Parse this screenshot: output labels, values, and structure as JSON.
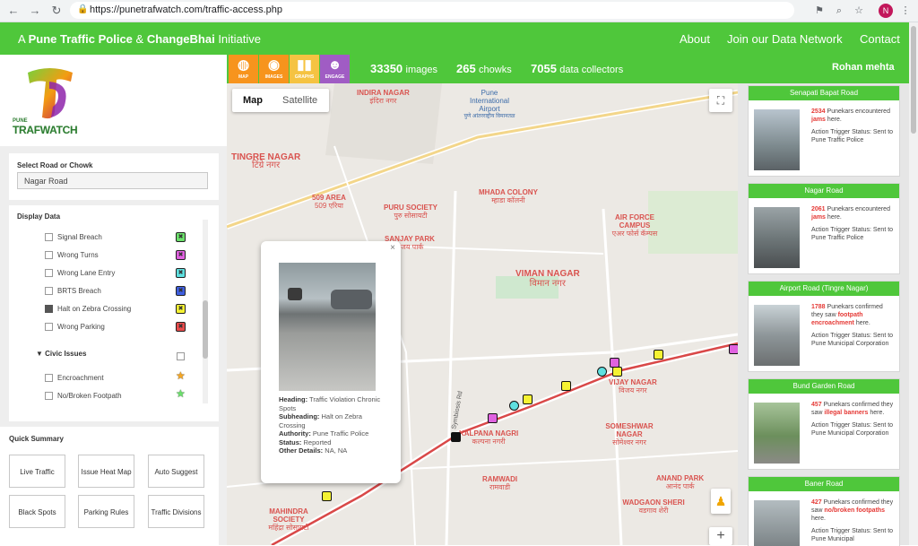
{
  "browser": {
    "url": "https://punetrafwatch.com/traffic-access.php",
    "profile_initial": "N"
  },
  "header": {
    "brand_prefix": "A",
    "brand_org1": "Pune Traffic Police",
    "brand_amp": "&",
    "brand_org2": "ChangeBhai",
    "brand_suffix": "Initiative",
    "nav": [
      "About",
      "Join our Data Network",
      "Contact"
    ]
  },
  "logo": {
    "letter": "T",
    "line1": "PUNE",
    "line2": "TRAFWATCH"
  },
  "left": {
    "select_label": "Select Road or Chowk",
    "select_value": "Nagar Road",
    "display_label": "Display Data",
    "items": [
      {
        "label": "Signal Breach",
        "checked": false,
        "color": "#6be06b",
        "glyph": "✖"
      },
      {
        "label": "Wrong Turns",
        "checked": false,
        "color": "#e062e0",
        "glyph": "✖"
      },
      {
        "label": "Wrong Lane Entry",
        "checked": false,
        "color": "#5ee0e0",
        "glyph": "✖"
      },
      {
        "label": "BRTS Breach",
        "checked": false,
        "color": "#3f5fe0",
        "glyph": "✖"
      },
      {
        "label": "Halt on Zebra Crossing",
        "checked": true,
        "color": "#f5f233",
        "glyph": "✖"
      },
      {
        "label": "Wrong Parking",
        "checked": false,
        "color": "#e84a4a",
        "glyph": "✖"
      }
    ],
    "group_label": "Civic Issues",
    "group_items": [
      {
        "label": "Encroachment",
        "checked": false,
        "color": "#f5a623",
        "glyph": "★"
      },
      {
        "label": "No/Broken Footpath",
        "checked": false,
        "color": "#6be06b",
        "glyph": "★"
      }
    ],
    "quick_label": "Quick Summary",
    "quick_buttons": [
      "Live Traffic",
      "Issue Heat Map",
      "Auto Suggest",
      "Black Spots",
      "Parking Rules",
      "Traffic Divisions"
    ]
  },
  "statsbar": {
    "icons": [
      {
        "name": "MAP",
        "color": "#f7941d"
      },
      {
        "name": "IMAGES",
        "color": "#f7941d"
      },
      {
        "name": "GRAPHS",
        "color": "#f5c342"
      },
      {
        "name": "ENGAGE",
        "color": "#a05cc4"
      }
    ],
    "stats": [
      {
        "value": "33350",
        "label": "images"
      },
      {
        "value": "265",
        "label": "chowks"
      },
      {
        "value": "7055",
        "label": "data collectors"
      }
    ],
    "user": "Rohan mehta"
  },
  "map": {
    "tabs": [
      "Map",
      "Satellite"
    ],
    "labels": [
      {
        "en": "INDIRA NAGAR",
        "mr": "इंदिरा नगर",
        "color": "#d9534f"
      },
      {
        "en": "Pune International Airport",
        "mr": "पुणे आंतरराष्ट्रीय विमानतळ",
        "color": "#3a6aa8"
      },
      {
        "en": "TINGRE NAGAR",
        "mr": "टिंग्रे नगर",
        "color": "#d9534f"
      },
      {
        "en": "MHADA COLONY",
        "mr": "म्हाडा कॉलनी",
        "color": "#d9534f"
      },
      {
        "en": "509 AREA",
        "mr": "509 एरिया",
        "color": "#d9534f"
      },
      {
        "en": "PURU SOCIETY",
        "mr": "पुरु सोसायटी",
        "color": "#d9534f"
      },
      {
        "en": "AIR FORCE CAMPUS",
        "mr": "एअर फोर्स कॅम्पस",
        "color": "#d9534f"
      },
      {
        "en": "SANJAY PARK",
        "mr": "संजय पार्क",
        "color": "#d9534f"
      },
      {
        "en": "VIMAN NAGAR",
        "mr": "विमान नगर",
        "color": "#d9534f"
      },
      {
        "en": "VIJAY NAGAR",
        "mr": "विजय नगर",
        "color": "#d9534f"
      },
      {
        "en": "SOMESHWAR NAGAR",
        "mr": "सोमेश्वर नगर",
        "color": "#d9534f"
      },
      {
        "en": "KALPANA NAGRI",
        "mr": "कल्पना नगरी",
        "color": "#d9534f"
      },
      {
        "en": "RAMWADI",
        "mr": "रामवाडी",
        "color": "#d9534f"
      },
      {
        "en": "ANAND PARK",
        "mr": "आनंद पार्क",
        "color": "#d9534f"
      },
      {
        "en": "WADGAON SHERI",
        "mr": "वडगाव शेरी",
        "color": "#d9534f"
      },
      {
        "en": "MAHINDRA SOCIETY",
        "mr": "महिंद्रा सोसायटी",
        "color": "#d9534f"
      },
      {
        "en": "Symbiosis Rd",
        "mr": "",
        "color": "#555555"
      }
    ],
    "popup": {
      "heading_label": "Heading:",
      "heading": "Traffic Violation Chronic Spots",
      "subheading_label": "Subheading:",
      "subheading": "Halt on Zebra Crossing",
      "authority_label": "Authority:",
      "authority": "Pune Traffic Police",
      "status_label": "Status:",
      "status": "Reported",
      "other_label": "Other Details:",
      "other": "NA, NA"
    }
  },
  "feed": [
    {
      "title": "Senapati Bapat Road",
      "count": "2534",
      "msg_a": "Punekars encountered",
      "issue": "jams",
      "msg_b": "here.",
      "status": "Action Trigger Status: Sent to Pune Traffic Police"
    },
    {
      "title": "Nagar Road",
      "count": "2061",
      "msg_a": "Punekars encountered",
      "issue": "jams",
      "msg_b": "here.",
      "status": "Action Trigger Status: Sent to Pune Traffic Police"
    },
    {
      "title": "Airport Road (Tingre Nagar)",
      "count": "1788",
      "msg_a": "Punekars confirmed they saw",
      "issue": "footpath encroachment",
      "msg_b": "here.",
      "status": "Action Trigger Status: Sent to Pune Municipal Corporation"
    },
    {
      "title": "Bund Garden Road",
      "count": "457",
      "msg_a": "Punekars confirmed they saw",
      "issue": "illegal banners",
      "msg_b": "here.",
      "status": "Action Trigger Status: Sent to Pune Municipal Corporation"
    },
    {
      "title": "Baner Road",
      "count": "427",
      "msg_a": "Punekars confirmed they saw",
      "issue": "no/broken footpaths",
      "msg_b": "here.",
      "status": "Action Trigger Status: Sent to Pune Municipal"
    }
  ]
}
